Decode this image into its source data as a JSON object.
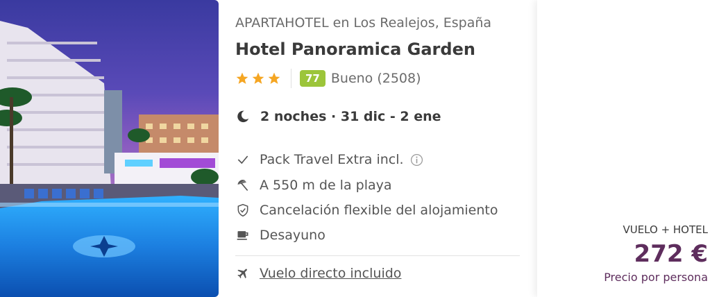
{
  "hotel": {
    "type_location": "APARTAHOTEL en Los Realejos, España",
    "name": "Hotel Panoramica Garden",
    "stars": 3,
    "score": "77",
    "rating_label": "Bueno (2508)"
  },
  "stay": {
    "summary": "2 noches · 31 dic - 2 ene",
    "icon": "moon-icon"
  },
  "features": [
    {
      "label": "Pack Travel Extra incl.",
      "icon": "check-icon",
      "has_info": true
    },
    {
      "label": "A 550 m de la playa",
      "icon": "beach-umbrella-icon"
    },
    {
      "label": "Cancelación flexible del alojamiento",
      "icon": "shield-check-icon"
    },
    {
      "label": "Desayuno",
      "icon": "coffee-cup-icon"
    }
  ],
  "flight": {
    "label": "Vuelo directo incluido",
    "icon": "airplane-icon"
  },
  "pricing": {
    "package": "VUELO + HOTEL",
    "price": "272 €",
    "per_person": "Precio por persona"
  },
  "colors": {
    "star": "#f5a623",
    "score_badge": "#9cc53a",
    "price": "#5e2d5d"
  }
}
